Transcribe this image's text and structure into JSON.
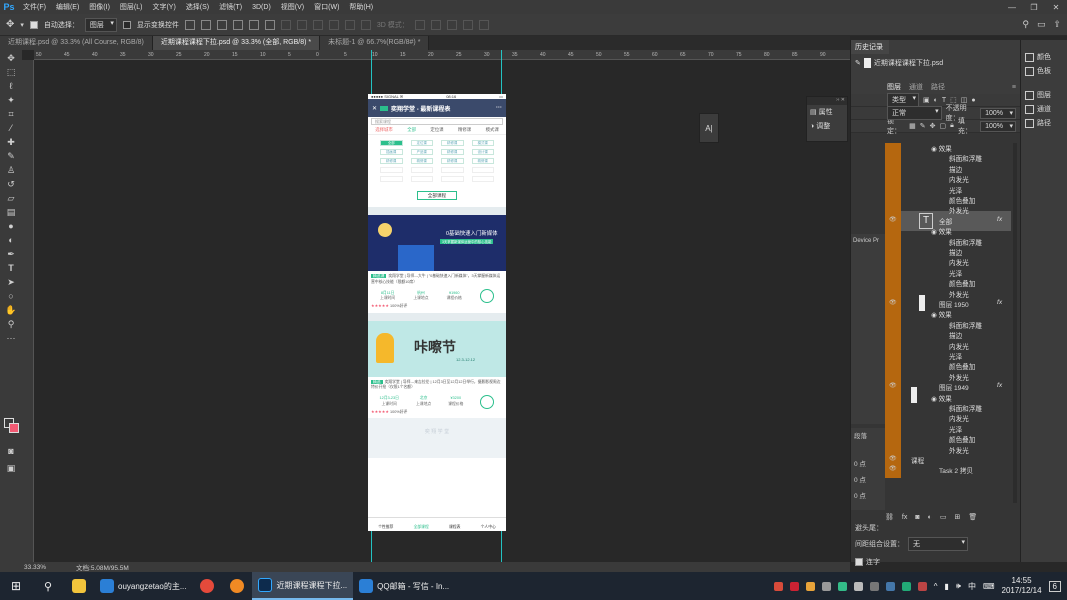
{
  "app": {
    "logo": "Ps",
    "window_controls": [
      "—",
      "❐",
      "✕"
    ]
  },
  "menu": [
    "文件(F)",
    "编辑(E)",
    "图像(I)",
    "图层(L)",
    "文字(Y)",
    "选择(S)",
    "滤镜(T)",
    "3D(D)",
    "视图(V)",
    "窗口(W)",
    "帮助(H)"
  ],
  "options": {
    "auto_select": "自动选择：",
    "auto_select_value": "图层",
    "show_transform": "显示变换控件",
    "mode3d": "3D 模式："
  },
  "tabs": [
    "近期课程.psd @ 33.3% (All Course, RGB/8)",
    "近期课程课程下拉.psd @ 33.3% (全部, RGB/8) *",
    "未标题-1 @ 66.7%(RGB/8#) *"
  ],
  "ruler_top": [
    "50",
    "45",
    "40",
    "35",
    "30",
    "25",
    "20",
    "15",
    "10",
    "5",
    "0",
    "5",
    "10",
    "15",
    "20",
    "25",
    "30",
    "35",
    "40",
    "45",
    "50",
    "55",
    "60",
    "65",
    "70",
    "75",
    "80",
    "85",
    "90"
  ],
  "phone": {
    "status_left": "●●●●● SIGNAL ✉",
    "status_mid": "08:16",
    "title": "奕翔学堂 - 最新课程表",
    "search_placeholder": "搜索课程",
    "tabs": [
      "选择城市",
      "全部",
      "定位课",
      "精修课",
      "模式课"
    ],
    "chips": [
      "全部",
      "定位课",
      "精修课",
      "模式课",
      "插画课",
      "产品课",
      "精修课",
      "设计课",
      "精修课",
      "精修课",
      "精修课",
      "精修课",
      "",
      "",
      "",
      "",
      "",
      "",
      "",
      ""
    ],
    "all_button": "全部课程",
    "banner1_title": "0基础快速入门新媒体",
    "banner1_sub": "3天掌握新媒体运营中的核心技能",
    "card1_tag": "精选课",
    "card1_text": "奕翔学堂 | 导师---大牛 | \"0基础快速入门新媒体\"，3天掌握新媒体运营中核心技能（限额10席）",
    "card1_stats": [
      {
        "v": "8月11日",
        "l": "上课时间"
      },
      {
        "v": "杭州",
        "l": "上课地点"
      },
      {
        "v": "¥1960",
        "l": "课程价格"
      }
    ],
    "card1_status": "100%好评",
    "banner2_title": "咔嚓节",
    "banner2_date": "12.3-12.12",
    "card2_tag": "精选",
    "card2_text": "奕翔学堂 | 导师---来吉拉伦 | 12月3日至12月12日举行，摄影影视周边特价开抢（仅限1个名额）",
    "card2_stats": [
      {
        "v": "12月3-23日",
        "l": "上课时间"
      },
      {
        "v": "北京",
        "l": "上课地点"
      },
      {
        "v": "¥3200",
        "l": "课程价格"
      }
    ],
    "card2_status": "100%好评",
    "footer_faded": "奕 翔 学 堂",
    "bottom_nav": [
      "个性推荐",
      "全部课程",
      "课程表",
      "个人中心"
    ]
  },
  "float_panels": {
    "props": "属性",
    "adjust": "调整",
    "text_tool": "A|"
  },
  "history": {
    "title": "历史记录",
    "doc": "近期课程课程下拉.psd"
  },
  "right_strip": [
    "颜色",
    "色板",
    "图层",
    "通道",
    "路径"
  ],
  "layers": {
    "tabs": [
      "图层",
      "通道",
      "路径"
    ],
    "filter": "类型",
    "blend": "正常",
    "opacity_label": "不透明度：",
    "opacity": "100%",
    "lock_label": "锁定：",
    "fill_label": "填充：",
    "fill": "100%",
    "rows": [
      {
        "t": "效果",
        "indent": 2
      },
      {
        "t": "斜面和浮雕",
        "indent": 3
      },
      {
        "t": "描边",
        "indent": 3
      },
      {
        "t": "内发光",
        "indent": 3
      },
      {
        "t": "光泽",
        "indent": 3
      },
      {
        "t": "颜色叠加",
        "indent": 3
      },
      {
        "t": "外发光",
        "indent": 3
      },
      {
        "t": "全部",
        "indent": 1
      },
      {
        "t": "效果",
        "indent": 2
      },
      {
        "t": "斜面和浮雕",
        "indent": 3
      },
      {
        "t": "描边",
        "indent": 3
      },
      {
        "t": "内发光",
        "indent": 3
      },
      {
        "t": "光泽",
        "indent": 3
      },
      {
        "t": "颜色叠加",
        "indent": 3
      },
      {
        "t": "外发光",
        "indent": 3
      },
      {
        "t": "图层 1950",
        "indent": 1
      },
      {
        "t": "效果",
        "indent": 2
      },
      {
        "t": "斜面和浮雕",
        "indent": 3
      },
      {
        "t": "描边",
        "indent": 3
      },
      {
        "t": "内发光",
        "indent": 3
      },
      {
        "t": "光泽",
        "indent": 3
      },
      {
        "t": "颜色叠加",
        "indent": 3
      },
      {
        "t": "外发光",
        "indent": 3
      },
      {
        "t": "图层 1949",
        "indent": 1
      },
      {
        "t": "效果",
        "indent": 2
      },
      {
        "t": "斜面和浮雕",
        "indent": 3
      },
      {
        "t": "内发光",
        "indent": 3
      },
      {
        "t": "光泽",
        "indent": 3
      },
      {
        "t": "颜色叠加",
        "indent": 3
      },
      {
        "t": "外发光",
        "indent": 3
      },
      {
        "t": "课程",
        "indent": 0
      },
      {
        "t": "Task 2 拷贝",
        "indent": 1
      }
    ],
    "device_label": "Device Pr",
    "side_label": "段落",
    "pts": [
      "0 点",
      "0 点",
      "0 点"
    ],
    "footer_fx": "fx",
    "footer_a": "避头尾：",
    "footer_b": "间距组合设置：",
    "footer_b_val": "无",
    "footer_c": "连字"
  },
  "status": {
    "zoom": "33.33%",
    "doc": "文档:5.08M/95.5M"
  },
  "taskbar": {
    "apps": [
      "ouyangzetao的主...",
      "近期课程课程下拉...",
      "QQ邮箱 - 写信 - In..."
    ],
    "time": "14:55",
    "date": "2017/12/14",
    "lang": "中",
    "notif": "6"
  }
}
